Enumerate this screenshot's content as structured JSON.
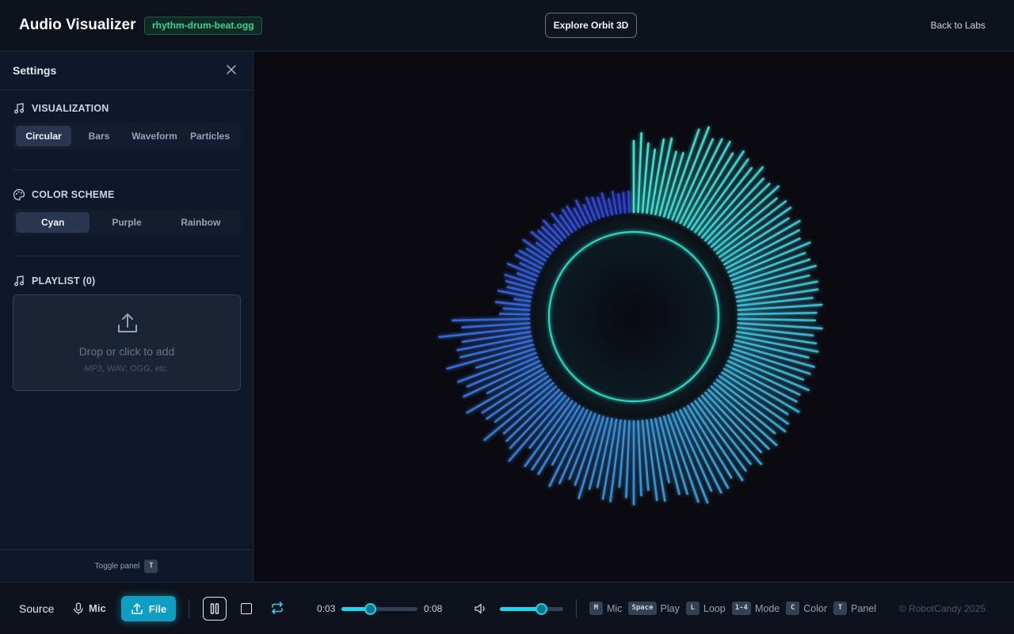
{
  "header": {
    "title": "Audio Visualizer",
    "file_badge": "rhythm-drum-beat.ogg",
    "explore_button": "Explore Orbit 3D",
    "back_link": "Back to Labs"
  },
  "sidebar": {
    "title": "Settings",
    "visualization": {
      "heading": "VISUALIZATION",
      "options": [
        "Circular",
        "Bars",
        "Waveform",
        "Particles"
      ],
      "selected": "Circular"
    },
    "color_scheme": {
      "heading": "COLOR SCHEME",
      "options": [
        "Cyan",
        "Purple",
        "Rainbow"
      ],
      "selected": "Cyan"
    },
    "playlist": {
      "heading": "PLAYLIST (0)",
      "drop_text": "Drop or click to add",
      "drop_hint": "MP3, WAV, OGG, etc."
    },
    "toggle_label": "Toggle panel",
    "toggle_key": "T"
  },
  "player": {
    "source_label": "Source",
    "mic_label": "Mic",
    "file_label": "File",
    "current_time": "0:03",
    "duration": "0:08",
    "progress": 0.375,
    "volume": 0.65,
    "shortcuts": [
      {
        "key": "M",
        "label": "Mic"
      },
      {
        "key": "Space",
        "label": "Play"
      },
      {
        "key": "L",
        "label": "Loop"
      },
      {
        "key": "1-4",
        "label": "Mode"
      },
      {
        "key": "C",
        "label": "Color"
      },
      {
        "key": "T",
        "label": "Panel"
      }
    ],
    "copyright": "© RobotCandy 2025"
  },
  "colors": {
    "accent": "#22d3ee",
    "gradient_start": "#40e0d0",
    "gradient_end": "#2f3fd6",
    "ring": "#2dd4bf"
  },
  "icons": [
    "music-note-icon",
    "palette-icon",
    "close-icon",
    "upload-icon",
    "mic-icon",
    "pause-icon",
    "stop-icon",
    "loop-icon",
    "volume-icon"
  ]
}
